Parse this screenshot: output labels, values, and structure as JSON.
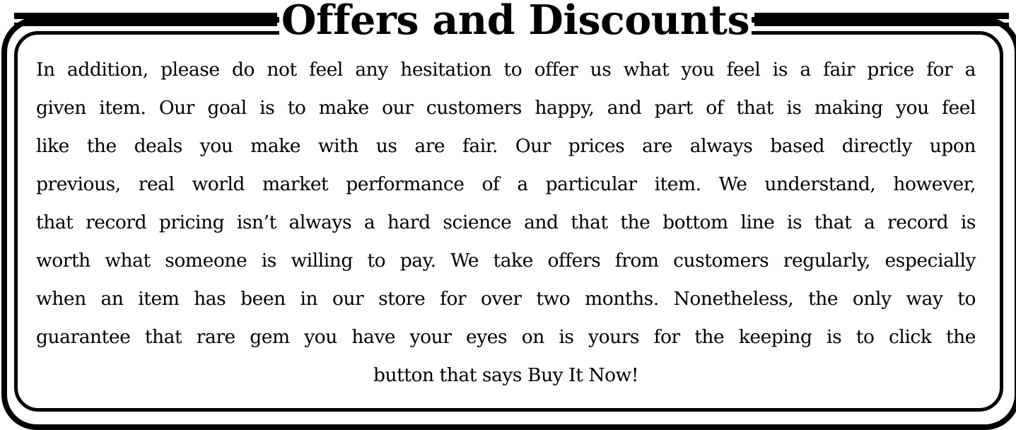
{
  "title": "Offers and Discounts",
  "body_lines": [
    "In addition, please do not feel any hesitation to offer us what you feel is a fair price for a",
    "given item. Our goal is to make our customers happy, and part of that is making you feel",
    "like the deals you make with us are fair. Our prices are always based directly upon",
    "previous, real world market performance of a particular item. We understand, however,",
    "that record pricing isn’t always a hard science and that the bottom line is that a record is",
    "worth what someone is willing to pay. We take offers from customers regularly, especially",
    "when an item has been in our store for over two months. Nonetheless, the only way to",
    "guarantee that rare gem you have your eyes on is yours for the keeping is to click the",
    "button that says Buy It Now!"
  ],
  "colors": {
    "text": "#000000",
    "background": "#ffffff",
    "border": "#000000"
  }
}
